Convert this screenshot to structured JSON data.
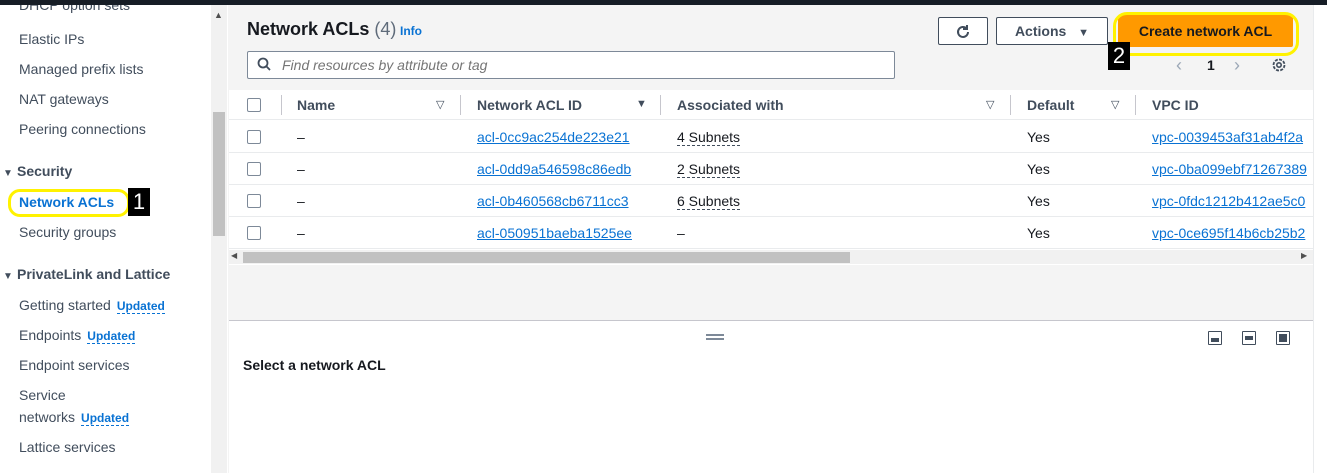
{
  "sidebar": {
    "items_top": [
      {
        "label": "DHCP option sets"
      },
      {
        "label": "Elastic IPs"
      },
      {
        "label": "Managed prefix lists"
      },
      {
        "label": "NAT gateways"
      },
      {
        "label": "Peering connections"
      }
    ],
    "security_section": {
      "label": "Security",
      "items": [
        {
          "label": "Network ACLs",
          "active": true
        },
        {
          "label": "Security groups"
        }
      ]
    },
    "privatelink_section": {
      "label": "PrivateLink and Lattice",
      "items": [
        {
          "label": "Getting started",
          "badge": "Updated"
        },
        {
          "label": "Endpoints",
          "badge": "Updated"
        },
        {
          "label": "Endpoint services"
        },
        {
          "label_line1": "Service",
          "label_line2": "networks",
          "badge": "Updated"
        },
        {
          "label": "Lattice services"
        }
      ]
    }
  },
  "markers": {
    "one": "1",
    "two": "2"
  },
  "header": {
    "title": "Network ACLs",
    "count": "(4)",
    "info": "Info",
    "actions_label": "Actions",
    "create_label": "Create network ACL"
  },
  "search": {
    "placeholder": "Find resources by attribute or tag"
  },
  "pagination": {
    "current_page": "1"
  },
  "table": {
    "columns": [
      "Name",
      "Network ACL ID",
      "Associated with",
      "Default",
      "VPC ID"
    ],
    "rows": [
      {
        "name": "–",
        "acl_id": "acl-0cc9ac254de223e21",
        "associated": "4 Subnets",
        "default": "Yes",
        "vpc_id": "vpc-0039453af31ab4f2a"
      },
      {
        "name": "–",
        "acl_id": "acl-0dd9a546598c86edb",
        "associated": "2 Subnets",
        "default": "Yes",
        "vpc_id": "vpc-0ba099ebf71267389"
      },
      {
        "name": "–",
        "acl_id": "acl-0b460568cb6711cc3",
        "associated": "6 Subnets",
        "default": "Yes",
        "vpc_id": "vpc-0fdc1212b412ae5c0"
      },
      {
        "name": "–",
        "acl_id": "acl-050951baeba1525ee",
        "associated": "–",
        "default": "Yes",
        "vpc_id": "vpc-0ce695f14b6cb25b2"
      }
    ]
  },
  "split_panel": {
    "title": "Select a network ACL"
  },
  "colors": {
    "accent": "#0972d3",
    "primary_button": "#ff9900",
    "highlight": "#fff200"
  }
}
